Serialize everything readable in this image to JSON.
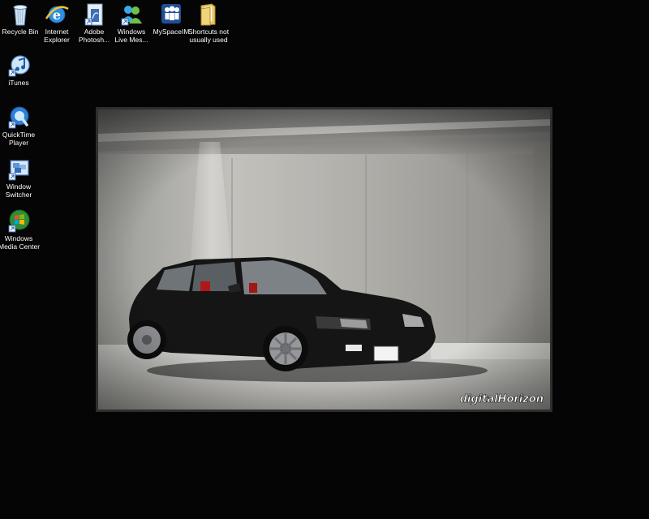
{
  "desktop": {
    "icons": [
      {
        "label_1": "Recycle Bin",
        "label_2": "",
        "icon": "recycle-bin-icon"
      },
      {
        "label_1": "Internet",
        "label_2": "Explorer",
        "icon": "internet-explorer-icon"
      },
      {
        "label_1": "Adobe",
        "label_2": "Photosh...",
        "icon": "adobe-photoshop-icon"
      },
      {
        "label_1": "Windows",
        "label_2": "Live Mes...",
        "icon": "windows-live-messenger-icon"
      },
      {
        "label_1": "MySpaceIM",
        "label_2": "",
        "icon": "myspaceim-icon"
      },
      {
        "label_1": "Shortcuts not",
        "label_2": "usually used",
        "icon": "folder-icon"
      },
      {
        "label_1": "iTunes",
        "label_2": "",
        "icon": "itunes-icon"
      },
      {
        "label_1": "QuickTime",
        "label_2": "Player",
        "icon": "quicktime-icon"
      },
      {
        "label_1": "Window",
        "label_2": "Switcher",
        "icon": "window-switcher-icon"
      },
      {
        "label_1": "Windows",
        "label_2": "Media Center",
        "icon": "windows-media-center-icon"
      }
    ]
  },
  "wallpaper": {
    "watermark": "digitalHorizon",
    "plate_text": "",
    "background_color": "#050505"
  }
}
